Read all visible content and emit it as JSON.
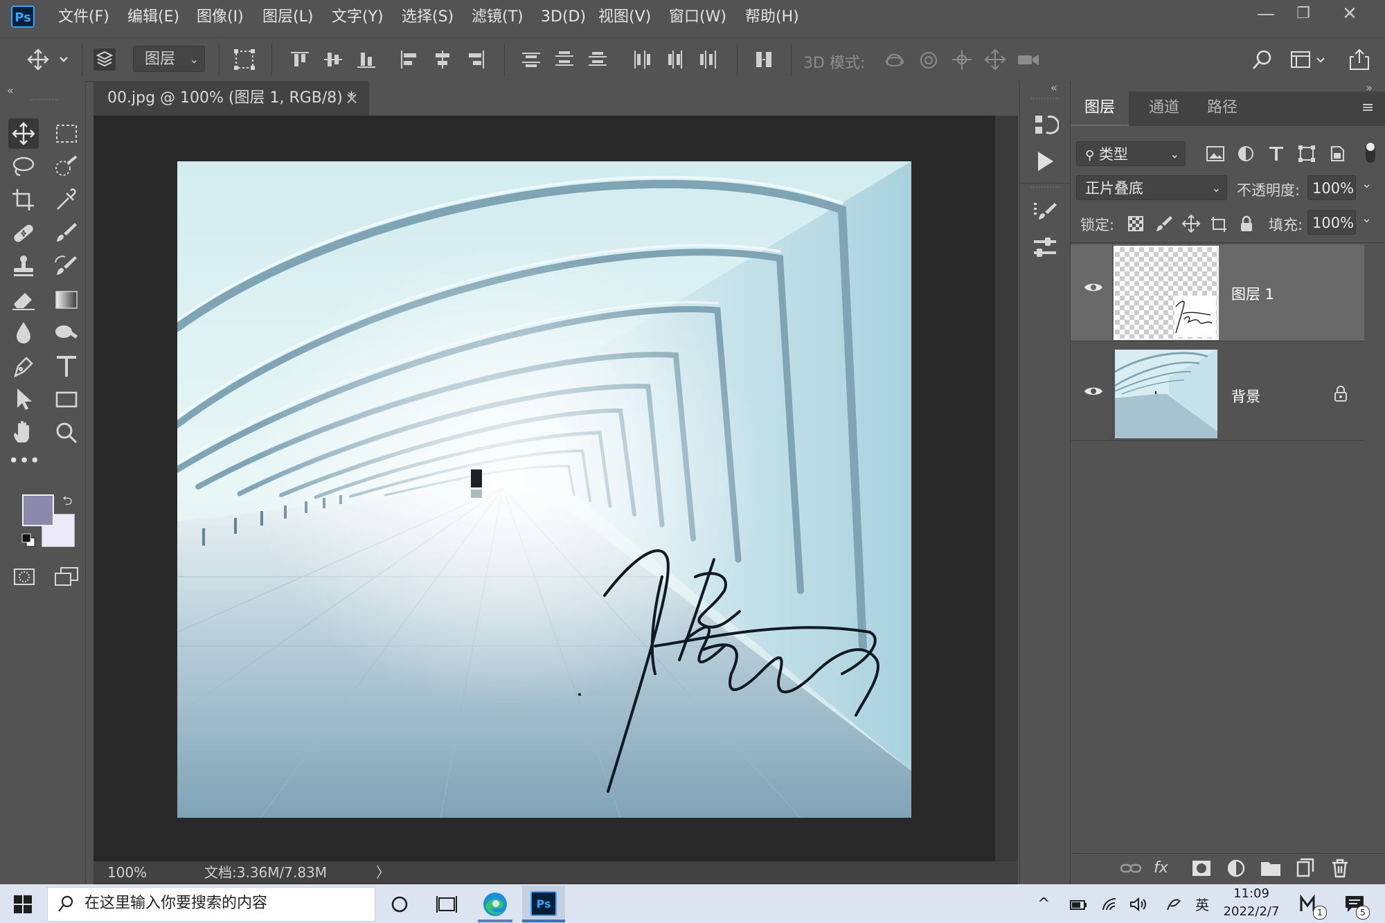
{
  "app": {
    "logo_text": "Ps"
  },
  "menu": [
    "文件(F)",
    "编辑(E)",
    "图像(I)",
    "图层(L)",
    "文字(Y)",
    "选择(S)",
    "滤镜(T)",
    "3D(D)",
    "视图(V)",
    "窗口(W)",
    "帮助(H)"
  ],
  "window_controls": {
    "minimize": "—",
    "restore": "❐",
    "close": "✕"
  },
  "options_bar": {
    "layer_select_value": "图层",
    "mode_3d_label": "3D 模式:"
  },
  "document": {
    "tab_title": "00.jpg @ 100% (图层 1, RGB/8) *",
    "tab_close": "×",
    "zoom": "100%",
    "doc_info": "文档:3.36M/7.83M",
    "status_arrow": "〉"
  },
  "colors": {
    "foreground": "#8c88ac",
    "background": "#ece9f8",
    "accent": "#31a8ff"
  },
  "layers_panel": {
    "tabs": [
      "图层",
      "通道",
      "路径"
    ],
    "active_tab": "图层",
    "filter_label": "类型",
    "blend_mode": "正片叠底",
    "opacity_label": "不透明度:",
    "opacity_value": "100%",
    "lock_label": "锁定:",
    "fill_label": "填充:",
    "fill_value": "100%",
    "layers": [
      {
        "name": "图层 1",
        "visible": true,
        "selected": true,
        "locked": false
      },
      {
        "name": "背景",
        "visible": true,
        "selected": false,
        "locked": true
      }
    ]
  },
  "taskbar": {
    "search_placeholder": "在这里输入你要搜索的内容",
    "ime": "英",
    "time": "11:09",
    "date": "2022/2/7",
    "notification_count": "5",
    "app_badge": "1"
  }
}
